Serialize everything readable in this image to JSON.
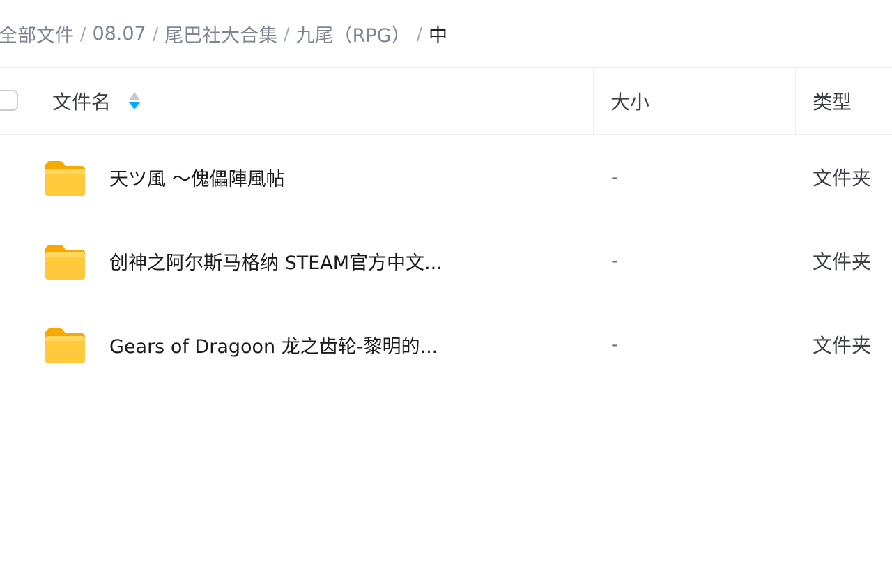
{
  "breadcrumb": {
    "items": [
      {
        "label": "全部文件"
      },
      {
        "label": "08.07"
      },
      {
        "label": "尾巴社大合集"
      },
      {
        "label": "九尾（RPG）"
      }
    ],
    "current": "中",
    "separator": "/"
  },
  "table": {
    "columns": {
      "name": "文件名",
      "size": "大小",
      "type": "类型"
    },
    "sort": {
      "column": "name",
      "direction": "descending"
    },
    "rows": [
      {
        "name": "天ツ風 ～傀儡陣風帖",
        "size": "-",
        "type": "文件夹",
        "icon": "folder-icon"
      },
      {
        "name": "创神之阿尔斯马格纳 STEAM官方中文...",
        "size": "-",
        "type": "文件夹",
        "icon": "folder-icon"
      },
      {
        "name": "Gears of Dragoon 龙之齿轮-黎明的...",
        "size": "-",
        "type": "文件夹",
        "icon": "folder-icon"
      }
    ]
  },
  "colors": {
    "accent": "#06a7ff",
    "folder": "#ffc12b"
  }
}
